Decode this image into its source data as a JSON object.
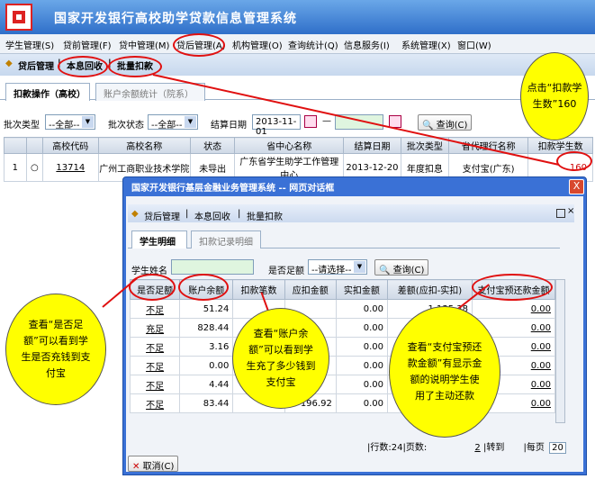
{
  "app_title": "国家开发银行高校助学贷款信息管理系统",
  "menu": [
    "学生管理(S)",
    "贷前管理(F)",
    "贷中管理(M)",
    "贷后管理(A)",
    "机构管理(O)",
    "查询统计(Q)",
    "信息服务(I)",
    "系统管理(X)",
    "窗口(W)"
  ],
  "subbar": {
    "root": "贷后管理",
    "item1": "本息回收",
    "item2": "批量扣款"
  },
  "tabs": {
    "t1": "扣款操作（高校）",
    "t2": "账户余额统计（院系）"
  },
  "filter": {
    "batch_type_label": "批次类型",
    "batch_type_value": "--全部--",
    "batch_status_label": "批次状态",
    "batch_status_value": "--全部--",
    "settle_date_label": "结算日期",
    "settle_date_from": "2013-11-01",
    "dash": "—",
    "settle_date_to": "",
    "query_button": "查询(C)"
  },
  "main_table": {
    "headers": [
      "",
      "",
      "高校代码",
      "高校名称",
      "状态",
      "省中心名称",
      "结算日期",
      "批次类型",
      "省代理行名称",
      "扣款学生数"
    ],
    "rows": [
      [
        "1",
        "○",
        "13714",
        "广州工商职业技术学院",
        "未导出",
        "广东省学生助学工作管理中心",
        "2013-12-20",
        "年度扣息",
        "支付宝(广东)",
        "160"
      ]
    ]
  },
  "dialog": {
    "title": "国家开发银行基层金融业务管理系统  --  网页对话框",
    "close": "X",
    "sub_root": "贷后管理",
    "sub_item1": "本息回收",
    "sub_item2": "批量扣款",
    "tab1": "学生明细",
    "tab2": "扣款记录明细",
    "name_label": "学生姓名",
    "name_value": "",
    "enough_label": "是否足额",
    "enough_value": "--请选择--",
    "query_button": "查询(C)",
    "headers": [
      "是否足额",
      "账户余额",
      "扣款笔数",
      "应扣金额",
      "实扣金额",
      "差额(应扣-实扣)",
      "支付宝预还款金额"
    ],
    "rows": [
      [
        "不足",
        "51.24",
        "",
        "",
        "0.00",
        "1,135.38",
        "0.00"
      ],
      [
        "充足",
        "828.44",
        "",
        "",
        "0.00",
        "",
        "0.00"
      ],
      [
        "不足",
        "3.16",
        "",
        "",
        "0.00",
        "",
        "0.00"
      ],
      [
        "不足",
        "0.00",
        "",
        "",
        "0.00",
        "",
        "0.00"
      ],
      [
        "不足",
        "4.44",
        "",
        "",
        "0.00",
        "",
        "0.00"
      ],
      [
        "不足",
        "83.44",
        "",
        "196.92",
        "0.00",
        "",
        "0.00"
      ]
    ],
    "pager": "|行数:24|页数:",
    "pager_page": "2",
    "pager_goto": "|转到",
    "pager_per": "|每页",
    "pager_per_value": "20",
    "cancel_button": "取消(C)"
  },
  "callouts": {
    "c1": "点击“扣款学生数”160",
    "c2": "查看“是否足额”可以看到学生是否充钱到支付宝",
    "c3": "查看“账户余额”可以看到学生充了多少钱到支付宝",
    "c4": "查看“支付宝预还款金额”有显示金额的说明学生使用了主动还款"
  }
}
